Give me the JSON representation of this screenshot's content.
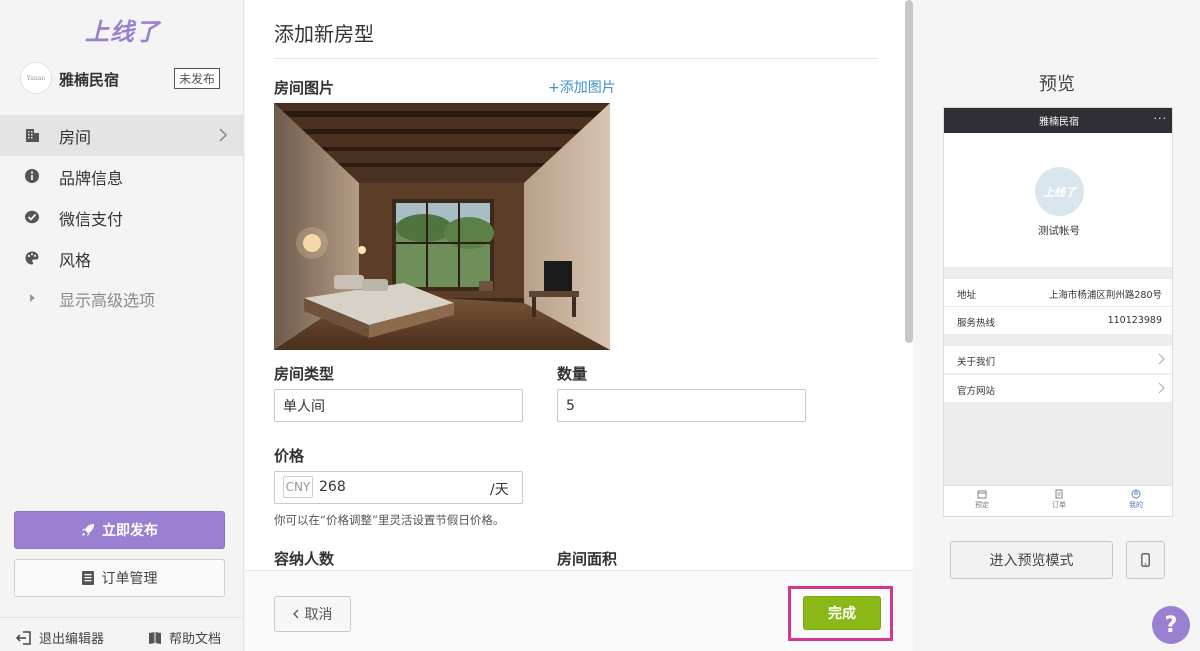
{
  "app": {
    "logo": "上线了"
  },
  "brand": {
    "avatar_text": "Yanan",
    "name": "雅楠民宿",
    "status": "未发布"
  },
  "nav": {
    "items": [
      {
        "label": "房间",
        "icon": "building-icon"
      },
      {
        "label": "品牌信息",
        "icon": "info-icon"
      },
      {
        "label": "微信支付",
        "icon": "wechat-pay-icon"
      },
      {
        "label": "风格",
        "icon": "palette-icon"
      }
    ],
    "advanced": "显示高级选项"
  },
  "actions": {
    "publish": "立即发布",
    "orders": "订单管理"
  },
  "footer": {
    "exit": "退出编辑器",
    "help": "帮助文档"
  },
  "form": {
    "title": "添加新房型",
    "room_image_label": "房间图片",
    "add_image": "+添加图片",
    "room_type_label": "房间类型",
    "room_type_value": "单人间",
    "quantity_label": "数量",
    "quantity_value": "5",
    "price_label": "价格",
    "currency": "CNY",
    "price_value": "268",
    "price_unit": "/天",
    "price_hint": "你可以在“价格调整”里灵活设置节假日价格。",
    "capacity_label": "容纳人数",
    "area_label": "房间面积",
    "cancel": "取消",
    "done": "完成"
  },
  "preview": {
    "title": "预览",
    "app_bar_title": "雅楠民宿",
    "app_bar_more": "···",
    "avatar_text": "上线了",
    "account": "测试帐号",
    "address_label": "地址",
    "address_value": "上海市杨浦区荆州路280号",
    "hotline_label": "服务热线",
    "hotline_value": "110123989",
    "about": "关于我们",
    "website": "官方网站",
    "tabs": [
      {
        "label": "预定",
        "icon": "calendar-icon"
      },
      {
        "label": "订单",
        "icon": "document-icon"
      },
      {
        "label": "我的",
        "icon": "user-icon"
      }
    ],
    "enter_mode": "进入预览模式",
    "help_symbol": "?"
  },
  "colors": {
    "accent": "#9b7fd0",
    "done": "#8ab817",
    "highlight": "#d5368e",
    "link": "#3d92c8"
  }
}
